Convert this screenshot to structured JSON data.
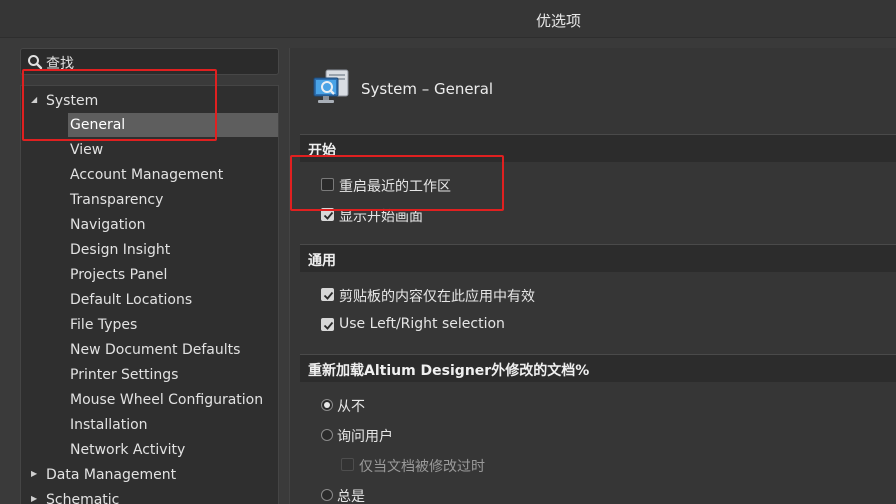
{
  "window": {
    "title": "优选项"
  },
  "search": {
    "label": "查找"
  },
  "tree": {
    "root": "System",
    "children": [
      "General",
      "View",
      "Account Management",
      "Transparency",
      "Navigation",
      "Design Insight",
      "Projects Panel",
      "Default Locations",
      "File Types",
      "New Document Defaults",
      "Printer Settings",
      "Mouse Wheel Configuration",
      "Installation",
      "Network Activity"
    ],
    "selected": "General",
    "after": [
      "Data Management",
      "Schematic"
    ]
  },
  "page": {
    "title": "System – General",
    "icon": "system-general-icon",
    "sections": {
      "start": {
        "title": "开始",
        "options": [
          {
            "label": "重启最近的工作区",
            "checked": false
          },
          {
            "label": "显示开始画面",
            "checked": true
          }
        ]
      },
      "general": {
        "title": "通用",
        "options": [
          {
            "label": "剪贴板的内容仅在此应用中有效",
            "checked": true
          },
          {
            "label": "Use Left/Right selection",
            "checked": true
          }
        ]
      },
      "reload": {
        "title": "重新加载Altium Designer外修改的文档%",
        "options": [
          {
            "label": "从不",
            "selected": true
          },
          {
            "label": "询问用户",
            "selected": false
          },
          {
            "label": "仅当文档被修改过时",
            "enabled": false
          },
          {
            "label": "总是",
            "selected": false
          }
        ]
      }
    }
  },
  "colors": {
    "highlight_box": "#e02020",
    "selected_row": "#5e5e5e"
  }
}
